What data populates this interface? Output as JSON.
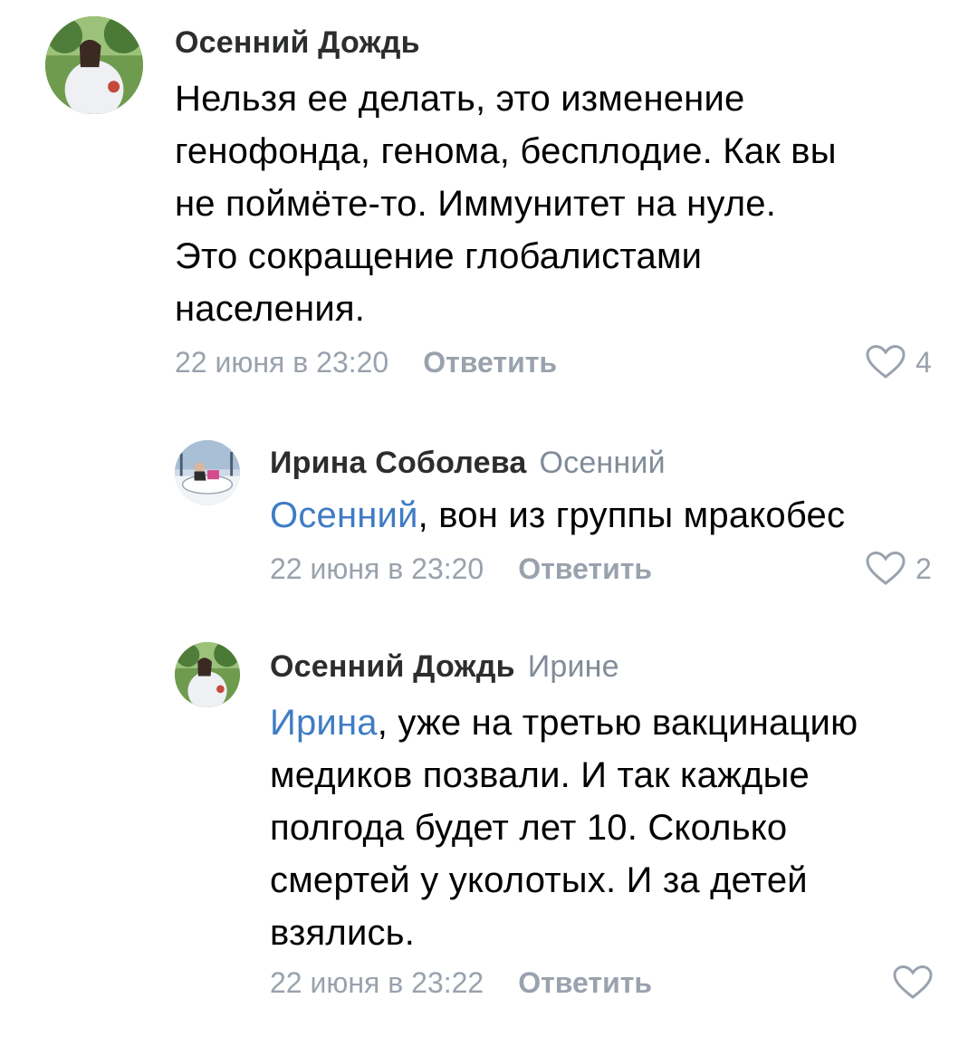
{
  "comments": [
    {
      "author": "Осенний Дождь",
      "reply_to": "",
      "mention": "",
      "text": "Нельзя ее делать, это изменение генофонда, генома, бесплодие. Как вы не поймёте-то. Иммунитет на нуле. Это сокращение глобалистами населения.",
      "lines": [
        "Нельзя ее делать, это изменение",
        "генофонда, генома, бесплодие. Как вы",
        "не поймёте-то. Иммунитет на нуле.",
        "Это сокращение глобалистами",
        "населения."
      ],
      "date": "22 июня в 23:20",
      "reply_label": "Ответить",
      "likes": "4"
    },
    {
      "author": "Ирина Соболева",
      "reply_to": "Осенний",
      "mention": "Осенний",
      "lines": [
        ", вон из группы мракобес"
      ],
      "date": "22 июня в 23:20",
      "reply_label": "Ответить",
      "likes": "2"
    },
    {
      "author": "Осенний Дождь",
      "reply_to": "Ирине",
      "mention": "Ирина",
      "lines": [
        ", уже на третью вакцинацию",
        "медиков позвали. И так каждые",
        "полгода будет лет 10. Сколько",
        "смертей у уколотых. И за детей",
        "взялись."
      ],
      "date": "22 июня в 23:22",
      "reply_label": "Ответить",
      "likes": ""
    }
  ],
  "colors": {
    "author": "#2c2d2e",
    "secondary": "#99a2ad",
    "mention": "#3f7cc4"
  },
  "icons": {
    "like": "heart-outline-icon"
  }
}
